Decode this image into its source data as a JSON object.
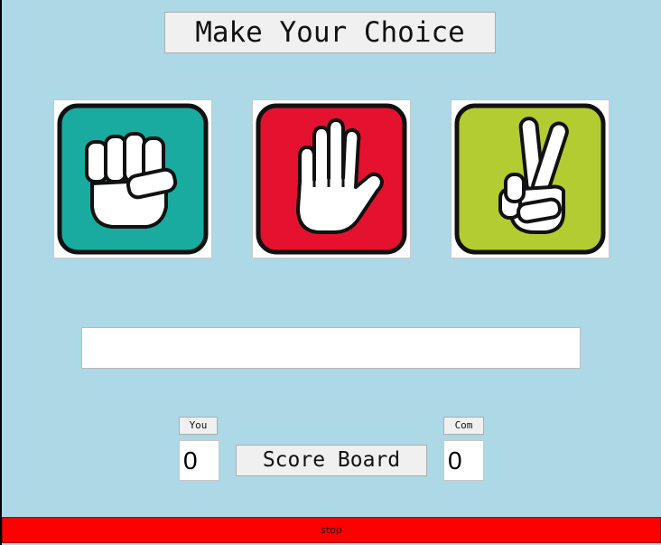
{
  "title": "Make Your Choice",
  "choices": {
    "rock": {
      "icon": "rock-fist-icon",
      "color": "#1aaba0"
    },
    "paper": {
      "icon": "paper-hand-icon",
      "color": "#e4122e"
    },
    "scissors": {
      "icon": "scissors-hand-icon",
      "color": "#b3cc32"
    }
  },
  "result": {
    "text": ""
  },
  "score": {
    "you_label": "You",
    "you_value": "0",
    "board_label": "Score Board",
    "com_label": "Com",
    "com_value": "0"
  },
  "stop_label": "stop",
  "colors": {
    "background": "#add8e6",
    "stop_button": "#ff0000"
  }
}
